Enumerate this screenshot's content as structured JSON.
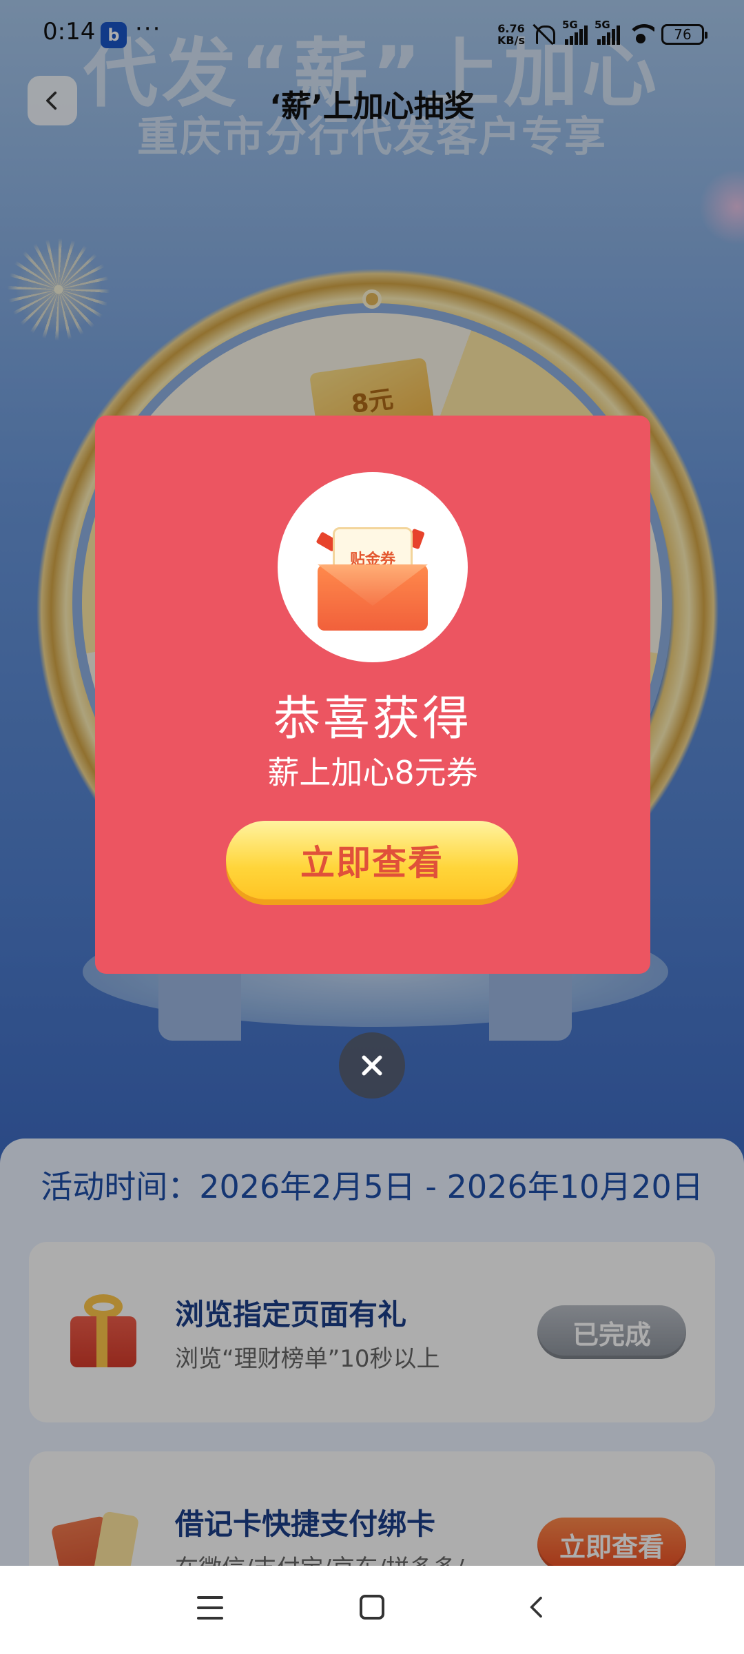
{
  "status_bar": {
    "time": "0:14",
    "app_icon_glyph": "b",
    "more": "···",
    "net_speed_value": "6.76",
    "net_speed_unit": "KB/s",
    "network1": "5G",
    "network2": "5G",
    "battery": "76"
  },
  "header": {
    "back_icon": "chevron-left-icon",
    "title": "‘薪’上加心抽奖"
  },
  "background": {
    "headline": "代发“薪”上加心",
    "subheadline": "重庆市分行代发客户专享",
    "wheel_prize": "8元"
  },
  "modal": {
    "icon": "voucher-envelope-icon",
    "voucher_label": "贴金券",
    "title": "恭喜获得",
    "prize": "薪上加心8元券",
    "button_label": "立即查看",
    "close_icon": "close-icon"
  },
  "activity": {
    "time_text": "活动时间：2026年2月5日 - 2026年10月20日",
    "tasks": [
      {
        "icon": "gift-icon",
        "title": "浏览指定页面有礼",
        "desc": "浏览“理财榜单”10秒以上",
        "button": "已完成",
        "status_color": "#9aa0a8"
      },
      {
        "icon": "bank-card-icon",
        "title": "借记卡快捷支付绑卡",
        "desc": "在微信/支付宝/京东/拼多多/",
        "button": "立即查看",
        "status_color": "#ee4e24"
      }
    ]
  },
  "nav_bar": {
    "menu_icon": "menu-icon",
    "home_icon": "home-icon",
    "back_icon": "back-icon"
  },
  "colors": {
    "modal_bg": "#ec5561",
    "button_yellow": "#ffd53a",
    "button_text": "#e0503a",
    "title_blue": "#1e4fa8"
  }
}
